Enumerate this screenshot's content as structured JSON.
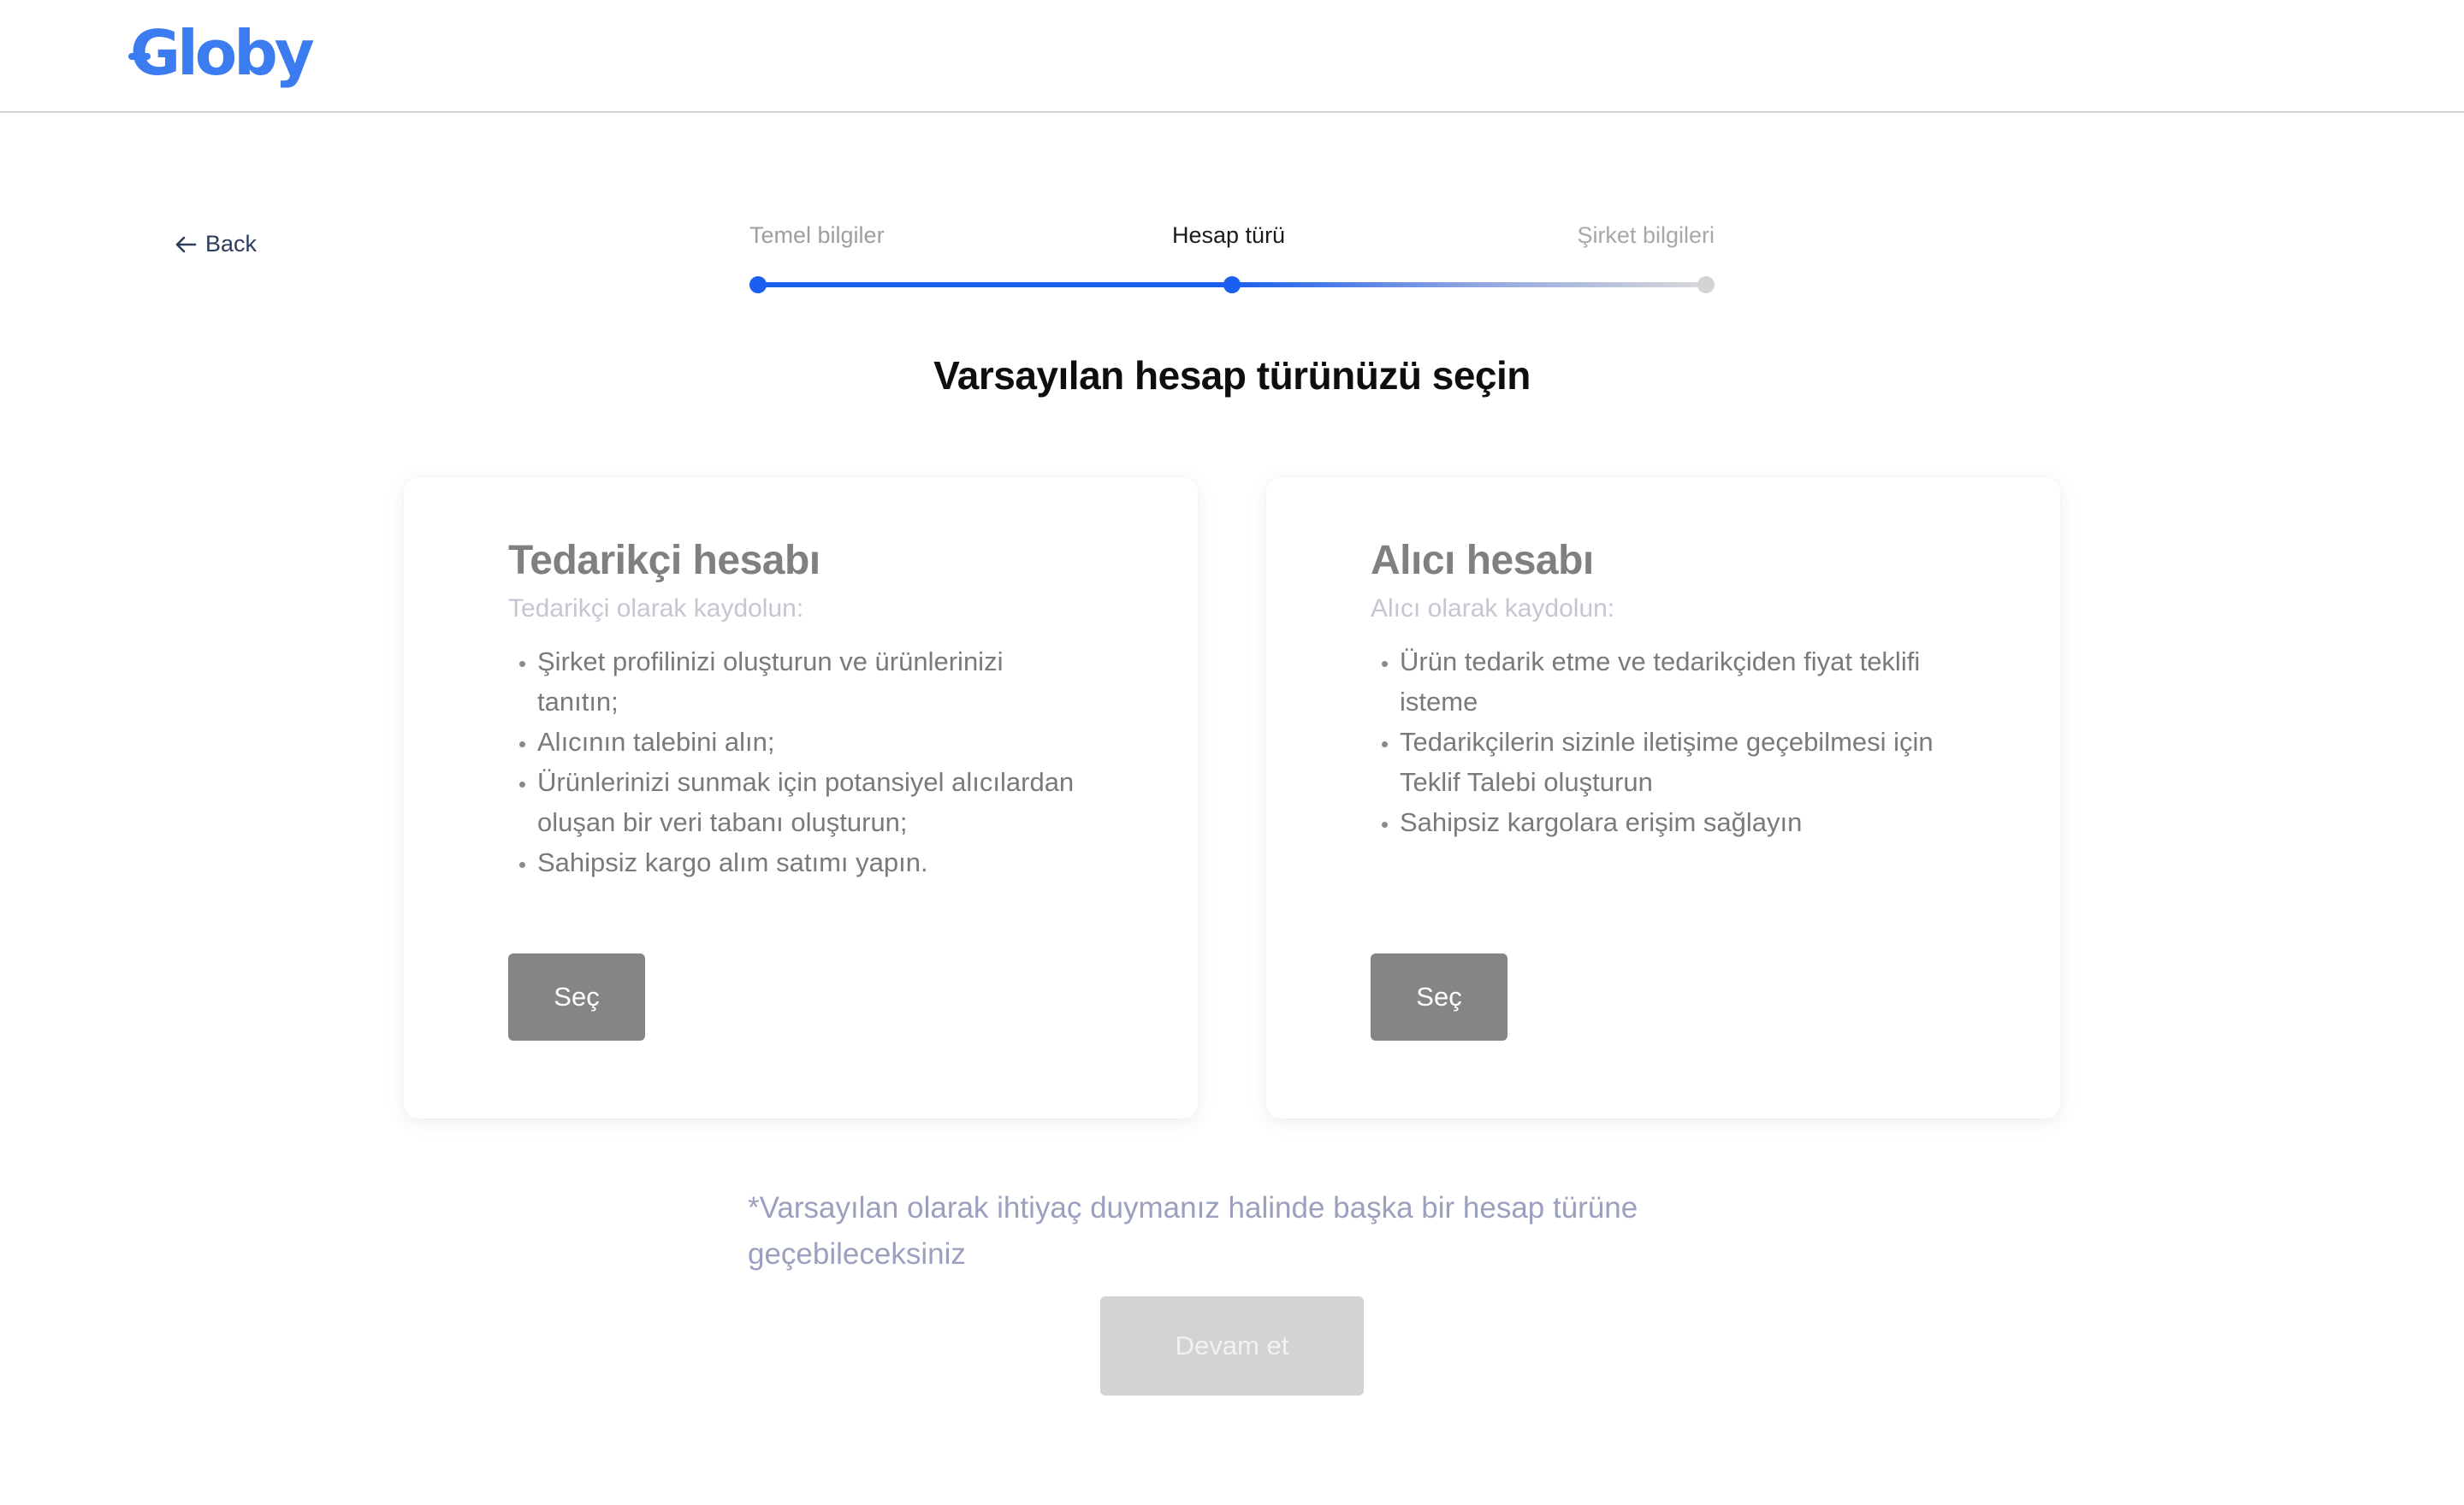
{
  "header": {
    "logo_text": "Globy",
    "brand_color": "#3b7cf0"
  },
  "nav": {
    "back_label": "Back",
    "back_icon": "arrow-left-icon"
  },
  "stepper": {
    "steps": [
      {
        "label": "Temel bilgiler",
        "state": "completed"
      },
      {
        "label": "Hesap türü",
        "state": "active"
      },
      {
        "label": "Şirket bilgileri",
        "state": "upcoming"
      }
    ],
    "progress_color": "#1a5ff0"
  },
  "main": {
    "title": "Varsayılan hesap türünüzü seçin",
    "cards": [
      {
        "title": "Tedarikçi hesabı",
        "subtitle": "Tedarikçi olarak kaydolun:",
        "items": [
          "Şirket profilinizi oluşturun ve ürünlerinizi tanıtın;",
          "Alıcının talebini alın;",
          "Ürünlerinizi sunmak için potansiyel alıcılardan oluşan bir veri tabanı oluşturun;",
          "Sahipsiz kargo alım satımı yapın."
        ],
        "button_label": "Seç"
      },
      {
        "title": "Alıcı hesabı",
        "subtitle": "Alıcı olarak kaydolun:",
        "items": [
          "Ürün tedarik etme ve tedarikçiden fiyat teklifi isteme",
          "Tedarikçilerin sizinle iletişime geçebilmesi için Teklif Talebi oluşturun",
          "Sahipsiz kargolara erişim sağlayın"
        ],
        "button_label": "Seç"
      }
    ],
    "footnote": "*Varsayılan olarak ihtiyaç duymanız halinde başka bir hesap türüne geçebileceksiniz",
    "continue_label": "Devam et",
    "continue_disabled": true
  }
}
